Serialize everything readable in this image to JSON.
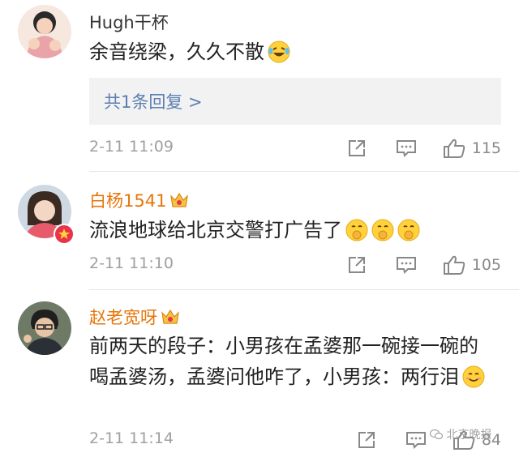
{
  "comments": [
    {
      "username": "Hugh干杯",
      "text": "余音绕梁，久久不散",
      "emoji_icons": [
        "laughing-tears-emoji"
      ],
      "replies_link": "共1条回复 >",
      "time": "2-11 11:09",
      "like_count": "115"
    },
    {
      "username": "白杨1541",
      "text": "流浪地球给北京交警打广告了",
      "emoji_icons": [
        "shush-emoji",
        "shush-emoji",
        "shush-emoji"
      ],
      "time": "2-11 11:10",
      "like_count": "105"
    },
    {
      "username": "赵老宽呀",
      "text": "前两天的段子：小男孩在孟婆那一碗接一碗的喝孟婆汤，孟婆问他咋了，小男孩：两行泪",
      "emoji_icons": [
        "smile-emoji"
      ],
      "time": "2-11 11:14",
      "like_count": "84"
    }
  ],
  "watermark": "北京晚报",
  "icons": {
    "share": "share-icon",
    "comment": "comment-icon",
    "like": "thumbs-up-icon",
    "vip": "crown-badge-icon"
  },
  "colors": {
    "username_plain": "#333333",
    "username_vip": "#e8760a",
    "reply_link": "#5b7fb3",
    "reply_bg": "#f2f2f2",
    "meta_gray": "#a0a0a0"
  }
}
